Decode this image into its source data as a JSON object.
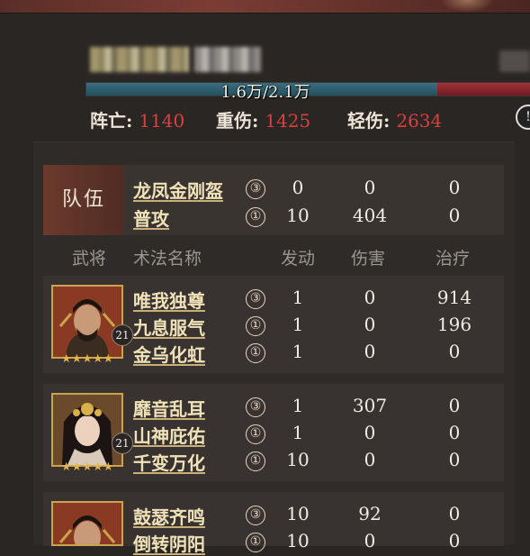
{
  "hp": {
    "text": "1.6万/2.1万",
    "current": 1.6,
    "max": 2.1,
    "unit": "万",
    "red_start_fraction": 0.79
  },
  "losses": {
    "dead_label": "阵亡:",
    "dead_value": "1140",
    "heavy_label": "重伤:",
    "heavy_value": "1425",
    "light_label": "轻伤:",
    "light_value": "2634"
  },
  "colors": {
    "loss_value": "#d94040",
    "hp_fill": "#2e6070",
    "hp_red": "#8e2930",
    "accent_gold": "#c9a44d"
  },
  "team": {
    "label": "队伍",
    "rows": [
      {
        "skill": "龙凤金刚盔",
        "grade": "③",
        "trigger": "0",
        "damage": "0",
        "heal": "0"
      },
      {
        "skill": "普攻",
        "grade": "①",
        "trigger": "10",
        "damage": "404",
        "heal": "0"
      }
    ]
  },
  "headers": {
    "general": "武将",
    "skill": "术法名称",
    "trigger": "发动",
    "damage": "伤害",
    "heal": "治疗"
  },
  "generals": [
    {
      "level": "21",
      "stars": "★★★★★",
      "portrait_icon": "male-general-portrait-icon",
      "skills": [
        {
          "skill": "唯我独尊",
          "grade": "③",
          "trigger": "1",
          "damage": "0",
          "heal": "914"
        },
        {
          "skill": "九息服气",
          "grade": "①",
          "trigger": "1",
          "damage": "0",
          "heal": "196"
        },
        {
          "skill": "金乌化虹",
          "grade": "①",
          "trigger": "1",
          "damage": "0",
          "heal": "0"
        }
      ]
    },
    {
      "level": "21",
      "stars": "★★★★★",
      "portrait_icon": "female-general-portrait-icon",
      "skills": [
        {
          "skill": "靡音乱耳",
          "grade": "③",
          "trigger": "1",
          "damage": "307",
          "heal": "0"
        },
        {
          "skill": "山神庇佑",
          "grade": "①",
          "trigger": "1",
          "damage": "0",
          "heal": "0"
        },
        {
          "skill": "千变万化",
          "grade": "①",
          "trigger": "10",
          "damage": "0",
          "heal": "0"
        }
      ]
    },
    {
      "level": "",
      "stars": "",
      "portrait_icon": "male-general-portrait-icon",
      "skills": [
        {
          "skill": "鼓瑟齐鸣",
          "grade": "③",
          "trigger": "10",
          "damage": "92",
          "heal": "0"
        },
        {
          "skill": "倒转阴阳",
          "grade": "①",
          "trigger": "10",
          "damage": "0",
          "heal": "0"
        }
      ]
    }
  ]
}
